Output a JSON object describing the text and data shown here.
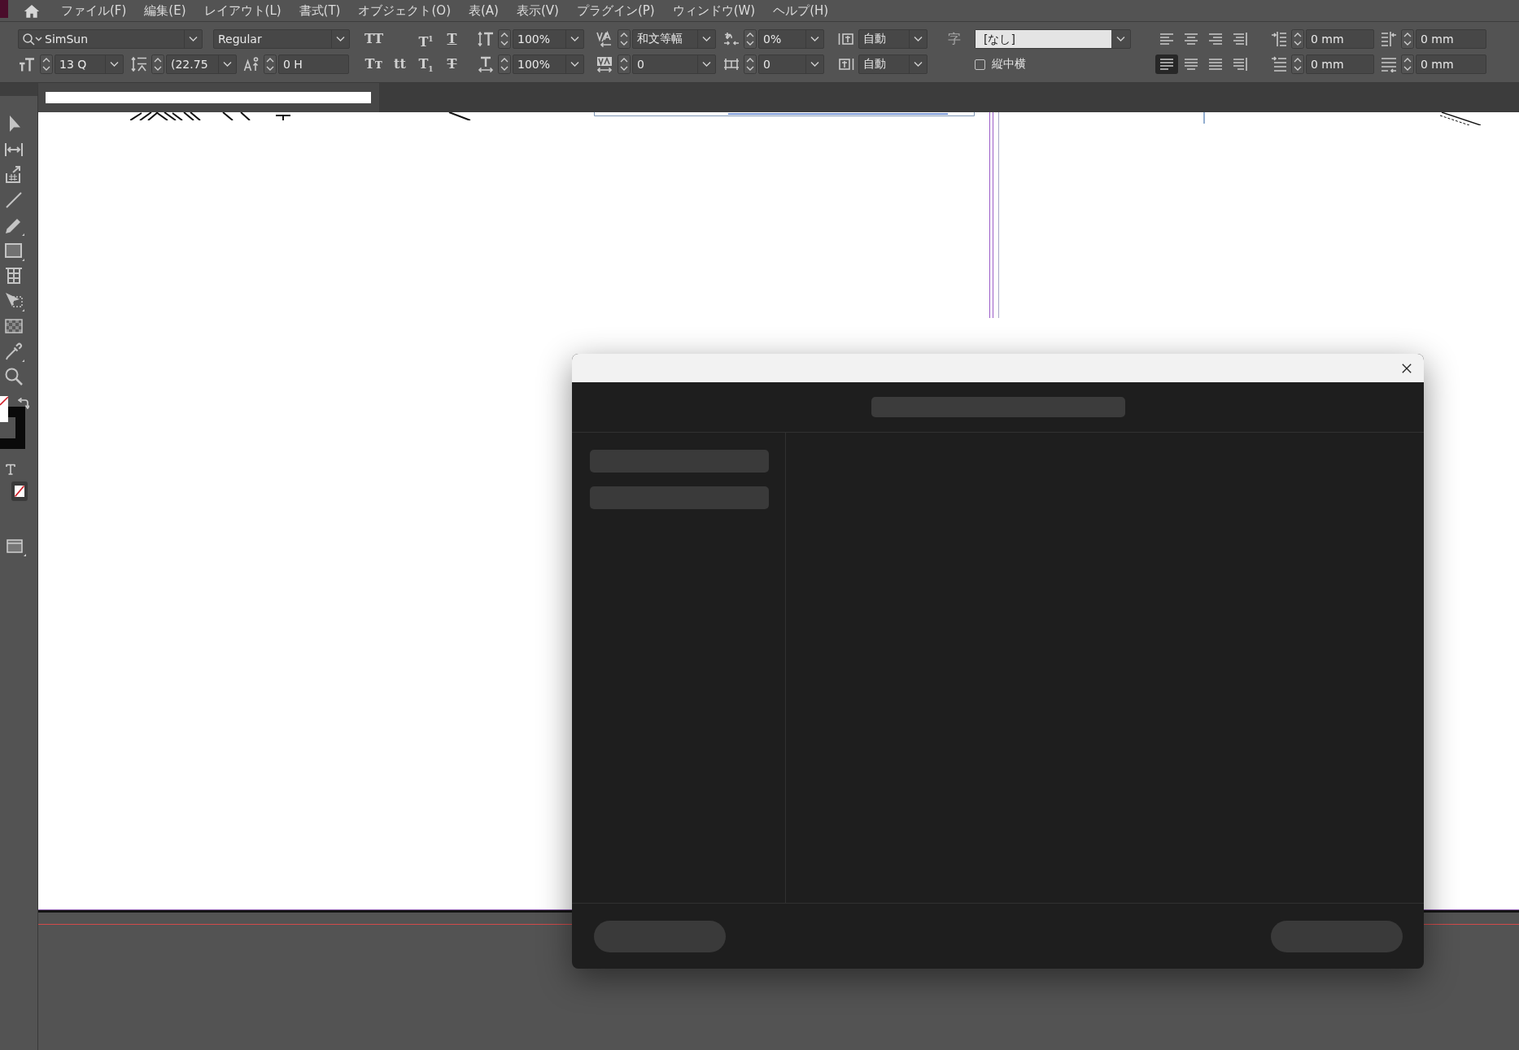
{
  "menu_bar": {
    "items": [
      "ファイル(F)",
      "編集(E)",
      "レイアウト(L)",
      "書式(T)",
      "オブジェクト(O)",
      "表(A)",
      "表示(V)",
      "プラグイン(P)",
      "ウィンドウ(W)",
      "ヘルプ(H)"
    ]
  },
  "control_panel": {
    "font_family": "SimSun",
    "font_style": "Regular",
    "font_size": "13 Q",
    "leading": "(22.75",
    "baseline_shift": "0 H",
    "type_style_buttons": {
      "row_1": [
        {
          "glyph": "TT",
          "kind": "plain"
        },
        {
          "glyph": "T$^{1}$",
          "kind": "plain"
        },
        {
          "glyph": "T",
          "kind": "underline"
        }
      ],
      "row_2": [
        {
          "glyph": "Tᴛ",
          "kind": "plain"
        },
        {
          "glyph": "tt",
          "kind": "plain"
        },
        {
          "glyph": "T$_{1}$",
          "kind": "plain"
        },
        {
          "glyph": "T",
          "kind": "strikethrough"
        }
      ]
    },
    "vertical_scale": "100%",
    "horizontal_scale": "100%",
    "kerning": "和文等幅",
    "tracking": "0",
    "tsume": "0%",
    "jidori": "0",
    "aki_before": "自動",
    "aki_after": "自動",
    "character_style_icon": "字",
    "character_style": "[なし]",
    "tatechuyoko": {
      "label": "縦中横",
      "checked": false
    },
    "alignment_buttons": [
      {
        "kind": "align_left",
        "selected": false
      },
      {
        "kind": "align_center",
        "selected": false
      },
      {
        "kind": "align_right",
        "selected": false
      },
      {
        "kind": "align_towards_spine",
        "selected": false
      },
      {
        "kind": "justify_left",
        "selected": true
      },
      {
        "kind": "justify_center",
        "selected": false
      },
      {
        "kind": "justify_all",
        "selected": false
      },
      {
        "kind": "align_away_from_spine",
        "selected": false
      }
    ],
    "left_indent": "0 mm",
    "right_indent": "0 mm",
    "first_line_indent": "0 mm",
    "last_line_indent": "0 mm"
  }
}
